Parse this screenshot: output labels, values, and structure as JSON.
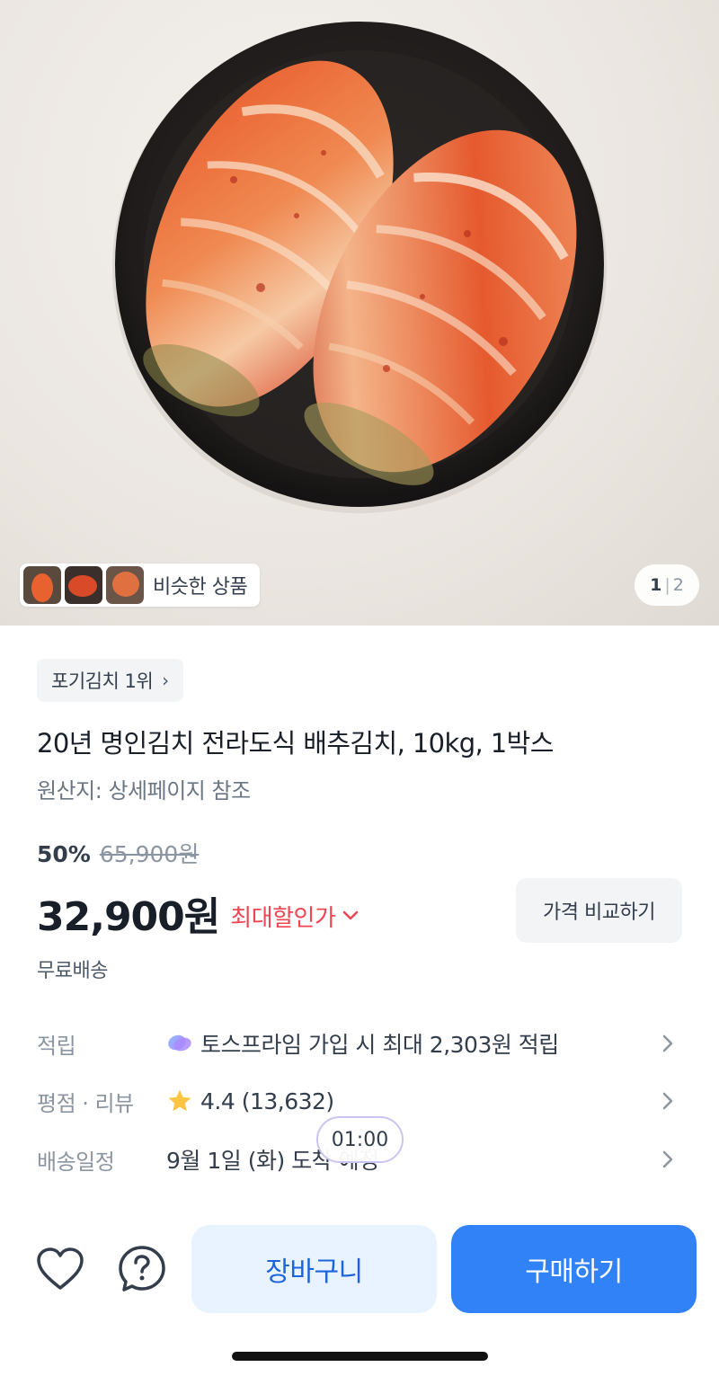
{
  "gallery": {
    "similar_label": "비슷한 상품",
    "page_current": "1",
    "page_separator": "|",
    "page_total": "2"
  },
  "product": {
    "rank_badge": "포기김치 1위",
    "title": "20년 명인김치 전라도식 배추김치, 10kg, 1박스",
    "origin": "원산지: 상세페이지 참조"
  },
  "pricing": {
    "discount_rate": "50%",
    "original_price": "65,900원",
    "price": "32,900원",
    "max_discount_label": "최대할인가",
    "compare_button": "가격 비교하기",
    "shipping": "무료배송"
  },
  "details": {
    "points": {
      "key": "적립",
      "value": "토스프라임 가입 시 최대 2,303원 적립"
    },
    "rating": {
      "key": "평점 · 리뷰",
      "value": "4.4 (13,632)"
    },
    "delivery": {
      "key": "배송일정",
      "value": "9월 1일 (화) 도착 예정"
    }
  },
  "timer": "01:00",
  "actions": {
    "cart": "장바구니",
    "buy": "구매하기"
  },
  "colors": {
    "accent_blue": "#3182f6",
    "cart_bg": "#e8f3ff",
    "discount_red": "#f04452",
    "star": "#ffc342"
  },
  "icons": [
    "chevron-right-icon",
    "chevron-down-icon",
    "prime-icon",
    "star-icon",
    "heart-icon",
    "question-icon"
  ]
}
